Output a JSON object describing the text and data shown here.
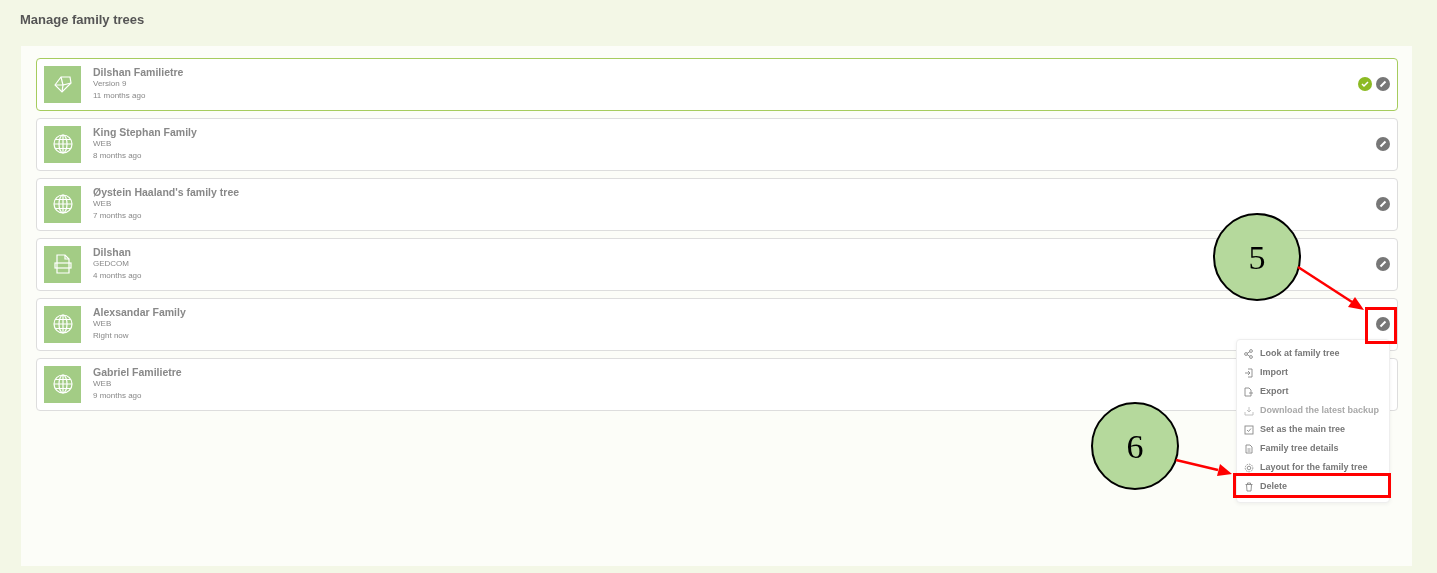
{
  "page": {
    "title": "Manage family trees"
  },
  "trees": [
    {
      "name": "Dilshan Familietre",
      "source": "Version 9",
      "updated": "11 months ago",
      "kind": "diamond",
      "main": true
    },
    {
      "name": "King Stephan Family",
      "source": "WEB",
      "updated": "8 months ago",
      "kind": "web",
      "main": false
    },
    {
      "name": "Øystein Haaland's family tree",
      "source": "WEB",
      "updated": "7 months ago",
      "kind": "web",
      "main": false
    },
    {
      "name": "Dilshan",
      "source": "GEDCOM",
      "updated": "4 months ago",
      "kind": "file",
      "main": false
    },
    {
      "name": "Alexsandar Family",
      "source": "WEB",
      "updated": "Right now",
      "kind": "web",
      "main": false,
      "menu_open": true
    },
    {
      "name": "Gabriel Familietre",
      "source": "WEB",
      "updated": "9 months ago",
      "kind": "web",
      "main": false
    }
  ],
  "menu": [
    {
      "label": "Look at family tree",
      "disabled": false
    },
    {
      "label": "Import",
      "disabled": false
    },
    {
      "label": "Export",
      "disabled": false
    },
    {
      "label": "Download the latest backup",
      "disabled": true
    },
    {
      "label": "Set as the main tree",
      "disabled": false
    },
    {
      "label": "Family tree details",
      "disabled": false
    },
    {
      "label": "Layout for the family tree",
      "disabled": false
    },
    {
      "label": "Delete",
      "disabled": false
    }
  ],
  "callouts": [
    {
      "label": "5"
    },
    {
      "label": "6"
    }
  ]
}
